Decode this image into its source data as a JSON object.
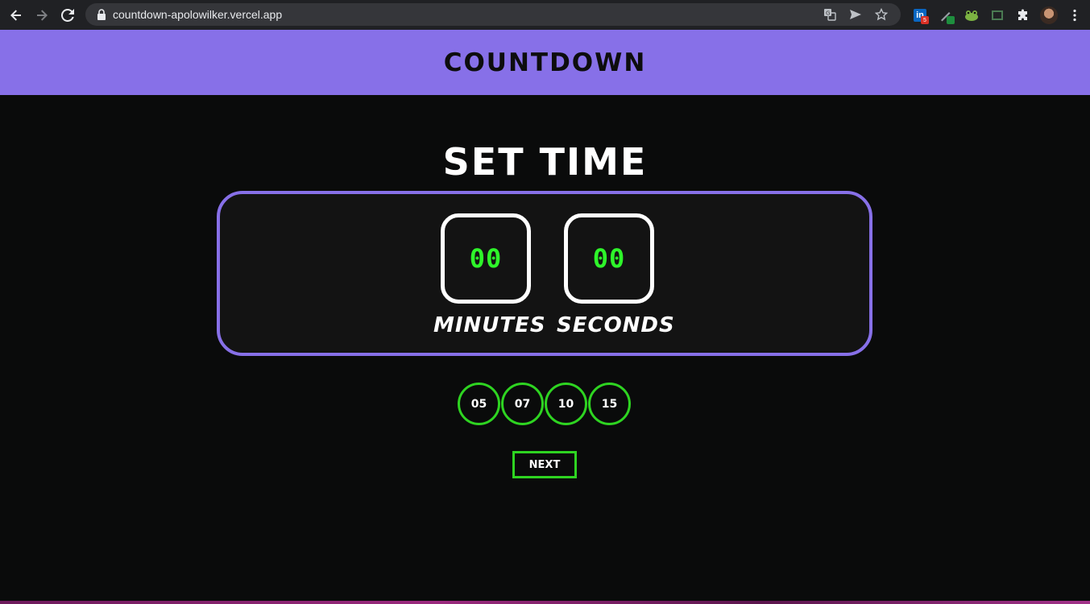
{
  "browser": {
    "url": "countdown-apolowilker.vercel.app",
    "extensions": [
      {
        "icon": "linkedin-extension-icon",
        "badge": "5",
        "badge_color": "#d93025"
      },
      {
        "icon": "pen-extension-icon",
        "badge": "",
        "badge_color": "#1e8e3e"
      },
      {
        "icon": "frog-extension-icon"
      },
      {
        "icon": "screen-capture-extension-icon"
      },
      {
        "icon": "puzzle-extensions-icon"
      }
    ]
  },
  "header": {
    "title": "COUNTDOWN"
  },
  "setup": {
    "title": "SET TIME",
    "minutes": {
      "value": "00",
      "label": "MINUTES"
    },
    "seconds": {
      "value": "00",
      "label": "SECONDS"
    },
    "presets": [
      "05",
      "07",
      "10",
      "15"
    ],
    "next_label": "NEXT"
  },
  "colors": {
    "accent": "#8770e8",
    "digits": "#2ef52a",
    "preset_ring": "#2ed421",
    "background": "#0a0b0b"
  }
}
